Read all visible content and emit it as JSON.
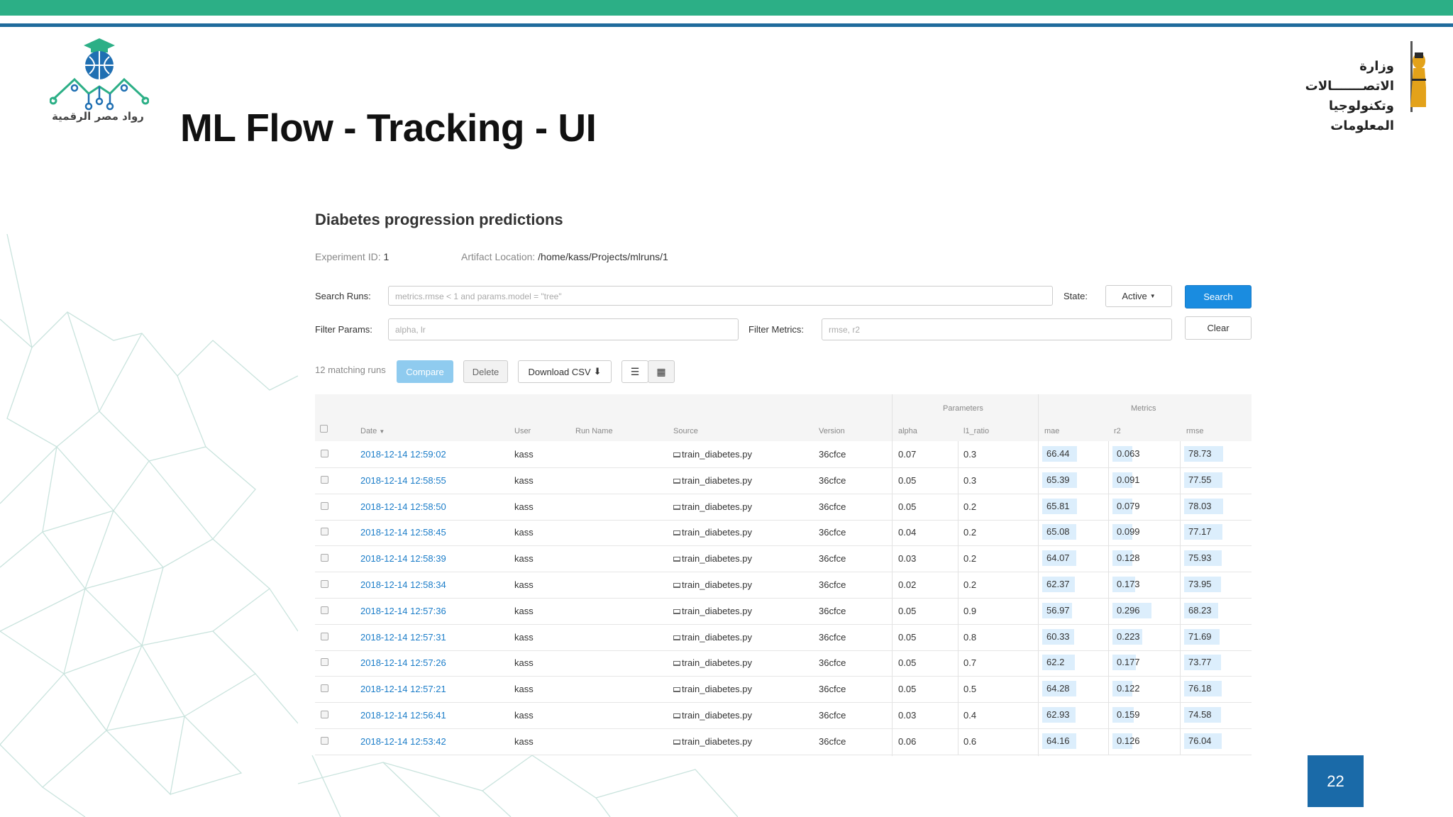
{
  "slide": {
    "title": "ML Flow - Tracking - UI",
    "page_number": "22",
    "logo_left_text": "رواد مصر الرقمية",
    "logo_right_text_line1": "وزارة الاتصـــــــالات",
    "logo_right_text_line2": "وتكنولوجيا المعلومات"
  },
  "colors": {
    "top_bar": "#2caf86",
    "top_line": "#1f6b9c",
    "page_badge": "#1a6aa8",
    "primary": "#1a8ce0"
  },
  "experiment": {
    "title": "Diabetes progression predictions",
    "id_label": "Experiment ID:",
    "id_value": "1",
    "artifact_label": "Artifact Location:",
    "artifact_value": "/home/kass/Projects/mlruns/1"
  },
  "search": {
    "runs_label": "Search Runs:",
    "runs_placeholder": "metrics.rmse < 1 and params.model = \"tree\"",
    "state_label": "State:",
    "state_value": "Active",
    "search_button": "Search",
    "params_label": "Filter Params:",
    "params_placeholder": "alpha, lr",
    "metrics_label": "Filter Metrics:",
    "metrics_placeholder": "rmse, r2",
    "clear_button": "Clear"
  },
  "toolbar": {
    "matching_runs": "12 matching runs",
    "compare": "Compare",
    "delete": "Delete",
    "download_csv": "Download CSV",
    "list_view_icon": "list-icon",
    "grid_view_icon": "table-icon"
  },
  "table": {
    "group_parameters": "Parameters",
    "group_metrics": "Metrics",
    "headers": [
      "Date",
      "User",
      "Run Name",
      "Source",
      "Version",
      "alpha",
      "l1_ratio",
      "mae",
      "r2",
      "rmse"
    ],
    "rows": [
      {
        "date": "2018-12-14 12:59:02",
        "user": "kass",
        "source": "train_diabetes.py",
        "version": "36cfce",
        "alpha": "0.07",
        "l1_ratio": "0.3",
        "mae": "66.44",
        "r2": "0.063",
        "rmse": "78.73"
      },
      {
        "date": "2018-12-14 12:58:55",
        "user": "kass",
        "source": "train_diabetes.py",
        "version": "36cfce",
        "alpha": "0.05",
        "l1_ratio": "0.3",
        "mae": "65.39",
        "r2": "0.091",
        "rmse": "77.55"
      },
      {
        "date": "2018-12-14 12:58:50",
        "user": "kass",
        "source": "train_diabetes.py",
        "version": "36cfce",
        "alpha": "0.05",
        "l1_ratio": "0.2",
        "mae": "65.81",
        "r2": "0.079",
        "rmse": "78.03"
      },
      {
        "date": "2018-12-14 12:58:45",
        "user": "kass",
        "source": "train_diabetes.py",
        "version": "36cfce",
        "alpha": "0.04",
        "l1_ratio": "0.2",
        "mae": "65.08",
        "r2": "0.099",
        "rmse": "77.17"
      },
      {
        "date": "2018-12-14 12:58:39",
        "user": "kass",
        "source": "train_diabetes.py",
        "version": "36cfce",
        "alpha": "0.03",
        "l1_ratio": "0.2",
        "mae": "64.07",
        "r2": "0.128",
        "rmse": "75.93"
      },
      {
        "date": "2018-12-14 12:58:34",
        "user": "kass",
        "source": "train_diabetes.py",
        "version": "36cfce",
        "alpha": "0.02",
        "l1_ratio": "0.2",
        "mae": "62.37",
        "r2": "0.173",
        "rmse": "73.95"
      },
      {
        "date": "2018-12-14 12:57:36",
        "user": "kass",
        "source": "train_diabetes.py",
        "version": "36cfce",
        "alpha": "0.05",
        "l1_ratio": "0.9",
        "mae": "56.97",
        "r2": "0.296",
        "rmse": "68.23"
      },
      {
        "date": "2018-12-14 12:57:31",
        "user": "kass",
        "source": "train_diabetes.py",
        "version": "36cfce",
        "alpha": "0.05",
        "l1_ratio": "0.8",
        "mae": "60.33",
        "r2": "0.223",
        "rmse": "71.69"
      },
      {
        "date": "2018-12-14 12:57:26",
        "user": "kass",
        "source": "train_diabetes.py",
        "version": "36cfce",
        "alpha": "0.05",
        "l1_ratio": "0.7",
        "mae": "62.2",
        "r2": "0.177",
        "rmse": "73.77"
      },
      {
        "date": "2018-12-14 12:57:21",
        "user": "kass",
        "source": "train_diabetes.py",
        "version": "36cfce",
        "alpha": "0.05",
        "l1_ratio": "0.5",
        "mae": "64.28",
        "r2": "0.122",
        "rmse": "76.18"
      },
      {
        "date": "2018-12-14 12:56:41",
        "user": "kass",
        "source": "train_diabetes.py",
        "version": "36cfce",
        "alpha": "0.03",
        "l1_ratio": "0.4",
        "mae": "62.93",
        "r2": "0.159",
        "rmse": "74.58"
      },
      {
        "date": "2018-12-14 12:53:42",
        "user": "kass",
        "source": "train_diabetes.py",
        "version": "36cfce",
        "alpha": "0.06",
        "l1_ratio": "0.6",
        "mae": "64.16",
        "r2": "0.126",
        "rmse": "76.04"
      }
    ]
  }
}
